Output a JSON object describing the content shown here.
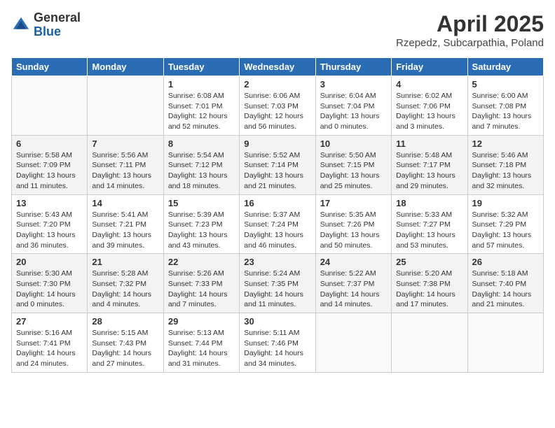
{
  "header": {
    "logo": {
      "general": "General",
      "blue": "Blue"
    },
    "title": "April 2025",
    "subtitle": "Rzepedz, Subcarpathia, Poland"
  },
  "days_of_week": [
    "Sunday",
    "Monday",
    "Tuesday",
    "Wednesday",
    "Thursday",
    "Friday",
    "Saturday"
  ],
  "weeks": [
    [
      {
        "day": "",
        "sunrise": "",
        "sunset": "",
        "daylight": ""
      },
      {
        "day": "",
        "sunrise": "",
        "sunset": "",
        "daylight": ""
      },
      {
        "day": "1",
        "sunrise": "Sunrise: 6:08 AM",
        "sunset": "Sunset: 7:01 PM",
        "daylight": "Daylight: 12 hours and 52 minutes."
      },
      {
        "day": "2",
        "sunrise": "Sunrise: 6:06 AM",
        "sunset": "Sunset: 7:03 PM",
        "daylight": "Daylight: 12 hours and 56 minutes."
      },
      {
        "day": "3",
        "sunrise": "Sunrise: 6:04 AM",
        "sunset": "Sunset: 7:04 PM",
        "daylight": "Daylight: 13 hours and 0 minutes."
      },
      {
        "day": "4",
        "sunrise": "Sunrise: 6:02 AM",
        "sunset": "Sunset: 7:06 PM",
        "daylight": "Daylight: 13 hours and 3 minutes."
      },
      {
        "day": "5",
        "sunrise": "Sunrise: 6:00 AM",
        "sunset": "Sunset: 7:08 PM",
        "daylight": "Daylight: 13 hours and 7 minutes."
      }
    ],
    [
      {
        "day": "6",
        "sunrise": "Sunrise: 5:58 AM",
        "sunset": "Sunset: 7:09 PM",
        "daylight": "Daylight: 13 hours and 11 minutes."
      },
      {
        "day": "7",
        "sunrise": "Sunrise: 5:56 AM",
        "sunset": "Sunset: 7:11 PM",
        "daylight": "Daylight: 13 hours and 14 minutes."
      },
      {
        "day": "8",
        "sunrise": "Sunrise: 5:54 AM",
        "sunset": "Sunset: 7:12 PM",
        "daylight": "Daylight: 13 hours and 18 minutes."
      },
      {
        "day": "9",
        "sunrise": "Sunrise: 5:52 AM",
        "sunset": "Sunset: 7:14 PM",
        "daylight": "Daylight: 13 hours and 21 minutes."
      },
      {
        "day": "10",
        "sunrise": "Sunrise: 5:50 AM",
        "sunset": "Sunset: 7:15 PM",
        "daylight": "Daylight: 13 hours and 25 minutes."
      },
      {
        "day": "11",
        "sunrise": "Sunrise: 5:48 AM",
        "sunset": "Sunset: 7:17 PM",
        "daylight": "Daylight: 13 hours and 29 minutes."
      },
      {
        "day": "12",
        "sunrise": "Sunrise: 5:46 AM",
        "sunset": "Sunset: 7:18 PM",
        "daylight": "Daylight: 13 hours and 32 minutes."
      }
    ],
    [
      {
        "day": "13",
        "sunrise": "Sunrise: 5:43 AM",
        "sunset": "Sunset: 7:20 PM",
        "daylight": "Daylight: 13 hours and 36 minutes."
      },
      {
        "day": "14",
        "sunrise": "Sunrise: 5:41 AM",
        "sunset": "Sunset: 7:21 PM",
        "daylight": "Daylight: 13 hours and 39 minutes."
      },
      {
        "day": "15",
        "sunrise": "Sunrise: 5:39 AM",
        "sunset": "Sunset: 7:23 PM",
        "daylight": "Daylight: 13 hours and 43 minutes."
      },
      {
        "day": "16",
        "sunrise": "Sunrise: 5:37 AM",
        "sunset": "Sunset: 7:24 PM",
        "daylight": "Daylight: 13 hours and 46 minutes."
      },
      {
        "day": "17",
        "sunrise": "Sunrise: 5:35 AM",
        "sunset": "Sunset: 7:26 PM",
        "daylight": "Daylight: 13 hours and 50 minutes."
      },
      {
        "day": "18",
        "sunrise": "Sunrise: 5:33 AM",
        "sunset": "Sunset: 7:27 PM",
        "daylight": "Daylight: 13 hours and 53 minutes."
      },
      {
        "day": "19",
        "sunrise": "Sunrise: 5:32 AM",
        "sunset": "Sunset: 7:29 PM",
        "daylight": "Daylight: 13 hours and 57 minutes."
      }
    ],
    [
      {
        "day": "20",
        "sunrise": "Sunrise: 5:30 AM",
        "sunset": "Sunset: 7:30 PM",
        "daylight": "Daylight: 14 hours and 0 minutes."
      },
      {
        "day": "21",
        "sunrise": "Sunrise: 5:28 AM",
        "sunset": "Sunset: 7:32 PM",
        "daylight": "Daylight: 14 hours and 4 minutes."
      },
      {
        "day": "22",
        "sunrise": "Sunrise: 5:26 AM",
        "sunset": "Sunset: 7:33 PM",
        "daylight": "Daylight: 14 hours and 7 minutes."
      },
      {
        "day": "23",
        "sunrise": "Sunrise: 5:24 AM",
        "sunset": "Sunset: 7:35 PM",
        "daylight": "Daylight: 14 hours and 11 minutes."
      },
      {
        "day": "24",
        "sunrise": "Sunrise: 5:22 AM",
        "sunset": "Sunset: 7:37 PM",
        "daylight": "Daylight: 14 hours and 14 minutes."
      },
      {
        "day": "25",
        "sunrise": "Sunrise: 5:20 AM",
        "sunset": "Sunset: 7:38 PM",
        "daylight": "Daylight: 14 hours and 17 minutes."
      },
      {
        "day": "26",
        "sunrise": "Sunrise: 5:18 AM",
        "sunset": "Sunset: 7:40 PM",
        "daylight": "Daylight: 14 hours and 21 minutes."
      }
    ],
    [
      {
        "day": "27",
        "sunrise": "Sunrise: 5:16 AM",
        "sunset": "Sunset: 7:41 PM",
        "daylight": "Daylight: 14 hours and 24 minutes."
      },
      {
        "day": "28",
        "sunrise": "Sunrise: 5:15 AM",
        "sunset": "Sunset: 7:43 PM",
        "daylight": "Daylight: 14 hours and 27 minutes."
      },
      {
        "day": "29",
        "sunrise": "Sunrise: 5:13 AM",
        "sunset": "Sunset: 7:44 PM",
        "daylight": "Daylight: 14 hours and 31 minutes."
      },
      {
        "day": "30",
        "sunrise": "Sunrise: 5:11 AM",
        "sunset": "Sunset: 7:46 PM",
        "daylight": "Daylight: 14 hours and 34 minutes."
      },
      {
        "day": "",
        "sunrise": "",
        "sunset": "",
        "daylight": ""
      },
      {
        "day": "",
        "sunrise": "",
        "sunset": "",
        "daylight": ""
      },
      {
        "day": "",
        "sunrise": "",
        "sunset": "",
        "daylight": ""
      }
    ]
  ]
}
